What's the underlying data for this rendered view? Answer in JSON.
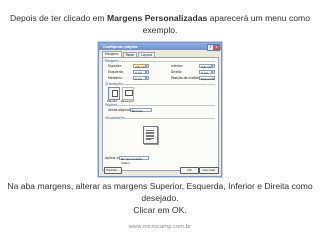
{
  "top_text": {
    "before": "Depois de ter clicado em ",
    "bold": "Margens Personalizadas",
    "after": " aparecerá um menu como exemplo."
  },
  "bottom_text": {
    "line1": "Na aba margens, alterar as margens Superior, Esquerda, Inferior e Direita como desejado.",
    "line2": "Clicar em OK."
  },
  "footer": "www.microcamp.com.br",
  "dialog": {
    "title": "Configurar página",
    "help_btn": "?",
    "close_btn": "x",
    "tabs": [
      "Margens",
      "Papel",
      "Layout"
    ],
    "margins_section": "Margens",
    "top_label": "Superior:",
    "top_value": "2,5 cm",
    "left_label": "Esquerda:",
    "left_value": "3 cm",
    "gutter_label": "Medianiz:",
    "gutter_value": "0 cm",
    "bottom_label": "Inferior:",
    "bottom_value": "2,5 cm",
    "right_label": "Direita:",
    "right_value": "3 cm",
    "gutter_pos_label": "Posição da medianiz:",
    "gutter_pos_value": "Esquerda",
    "orientation_section": "Orientação",
    "portrait": "Retrato",
    "landscape": "Paisagem",
    "pages_section": "Páginas",
    "multiple_pages_label": "Várias páginas:",
    "multiple_pages_value": "Normal",
    "preview_section": "Visualização",
    "apply_label": "Aplicar a:",
    "apply_value": "No documento inteiro",
    "default_btn": "Padrão...",
    "ok_btn": "OK",
    "cancel_btn": "Cancelar"
  }
}
